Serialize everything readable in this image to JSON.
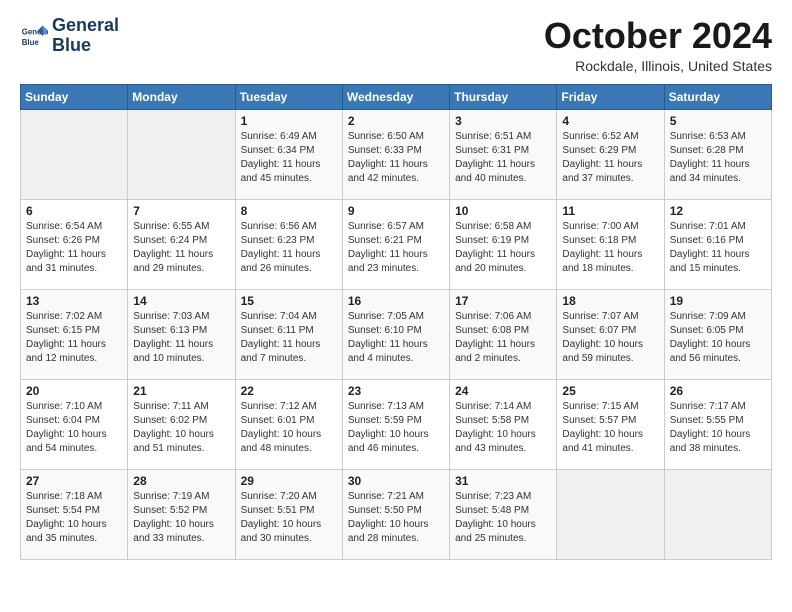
{
  "logo": {
    "line1": "General",
    "line2": "Blue"
  },
  "title": "October 2024",
  "location": "Rockdale, Illinois, United States",
  "days_header": [
    "Sunday",
    "Monday",
    "Tuesday",
    "Wednesday",
    "Thursday",
    "Friday",
    "Saturday"
  ],
  "weeks": [
    [
      {
        "day": "",
        "sunrise": "",
        "sunset": "",
        "daylight": ""
      },
      {
        "day": "",
        "sunrise": "",
        "sunset": "",
        "daylight": ""
      },
      {
        "day": "1",
        "sunrise": "Sunrise: 6:49 AM",
        "sunset": "Sunset: 6:34 PM",
        "daylight": "Daylight: 11 hours and 45 minutes."
      },
      {
        "day": "2",
        "sunrise": "Sunrise: 6:50 AM",
        "sunset": "Sunset: 6:33 PM",
        "daylight": "Daylight: 11 hours and 42 minutes."
      },
      {
        "day": "3",
        "sunrise": "Sunrise: 6:51 AM",
        "sunset": "Sunset: 6:31 PM",
        "daylight": "Daylight: 11 hours and 40 minutes."
      },
      {
        "day": "4",
        "sunrise": "Sunrise: 6:52 AM",
        "sunset": "Sunset: 6:29 PM",
        "daylight": "Daylight: 11 hours and 37 minutes."
      },
      {
        "day": "5",
        "sunrise": "Sunrise: 6:53 AM",
        "sunset": "Sunset: 6:28 PM",
        "daylight": "Daylight: 11 hours and 34 minutes."
      }
    ],
    [
      {
        "day": "6",
        "sunrise": "Sunrise: 6:54 AM",
        "sunset": "Sunset: 6:26 PM",
        "daylight": "Daylight: 11 hours and 31 minutes."
      },
      {
        "day": "7",
        "sunrise": "Sunrise: 6:55 AM",
        "sunset": "Sunset: 6:24 PM",
        "daylight": "Daylight: 11 hours and 29 minutes."
      },
      {
        "day": "8",
        "sunrise": "Sunrise: 6:56 AM",
        "sunset": "Sunset: 6:23 PM",
        "daylight": "Daylight: 11 hours and 26 minutes."
      },
      {
        "day": "9",
        "sunrise": "Sunrise: 6:57 AM",
        "sunset": "Sunset: 6:21 PM",
        "daylight": "Daylight: 11 hours and 23 minutes."
      },
      {
        "day": "10",
        "sunrise": "Sunrise: 6:58 AM",
        "sunset": "Sunset: 6:19 PM",
        "daylight": "Daylight: 11 hours and 20 minutes."
      },
      {
        "day": "11",
        "sunrise": "Sunrise: 7:00 AM",
        "sunset": "Sunset: 6:18 PM",
        "daylight": "Daylight: 11 hours and 18 minutes."
      },
      {
        "day": "12",
        "sunrise": "Sunrise: 7:01 AM",
        "sunset": "Sunset: 6:16 PM",
        "daylight": "Daylight: 11 hours and 15 minutes."
      }
    ],
    [
      {
        "day": "13",
        "sunrise": "Sunrise: 7:02 AM",
        "sunset": "Sunset: 6:15 PM",
        "daylight": "Daylight: 11 hours and 12 minutes."
      },
      {
        "day": "14",
        "sunrise": "Sunrise: 7:03 AM",
        "sunset": "Sunset: 6:13 PM",
        "daylight": "Daylight: 11 hours and 10 minutes."
      },
      {
        "day": "15",
        "sunrise": "Sunrise: 7:04 AM",
        "sunset": "Sunset: 6:11 PM",
        "daylight": "Daylight: 11 hours and 7 minutes."
      },
      {
        "day": "16",
        "sunrise": "Sunrise: 7:05 AM",
        "sunset": "Sunset: 6:10 PM",
        "daylight": "Daylight: 11 hours and 4 minutes."
      },
      {
        "day": "17",
        "sunrise": "Sunrise: 7:06 AM",
        "sunset": "Sunset: 6:08 PM",
        "daylight": "Daylight: 11 hours and 2 minutes."
      },
      {
        "day": "18",
        "sunrise": "Sunrise: 7:07 AM",
        "sunset": "Sunset: 6:07 PM",
        "daylight": "Daylight: 10 hours and 59 minutes."
      },
      {
        "day": "19",
        "sunrise": "Sunrise: 7:09 AM",
        "sunset": "Sunset: 6:05 PM",
        "daylight": "Daylight: 10 hours and 56 minutes."
      }
    ],
    [
      {
        "day": "20",
        "sunrise": "Sunrise: 7:10 AM",
        "sunset": "Sunset: 6:04 PM",
        "daylight": "Daylight: 10 hours and 54 minutes."
      },
      {
        "day": "21",
        "sunrise": "Sunrise: 7:11 AM",
        "sunset": "Sunset: 6:02 PM",
        "daylight": "Daylight: 10 hours and 51 minutes."
      },
      {
        "day": "22",
        "sunrise": "Sunrise: 7:12 AM",
        "sunset": "Sunset: 6:01 PM",
        "daylight": "Daylight: 10 hours and 48 minutes."
      },
      {
        "day": "23",
        "sunrise": "Sunrise: 7:13 AM",
        "sunset": "Sunset: 5:59 PM",
        "daylight": "Daylight: 10 hours and 46 minutes."
      },
      {
        "day": "24",
        "sunrise": "Sunrise: 7:14 AM",
        "sunset": "Sunset: 5:58 PM",
        "daylight": "Daylight: 10 hours and 43 minutes."
      },
      {
        "day": "25",
        "sunrise": "Sunrise: 7:15 AM",
        "sunset": "Sunset: 5:57 PM",
        "daylight": "Daylight: 10 hours and 41 minutes."
      },
      {
        "day": "26",
        "sunrise": "Sunrise: 7:17 AM",
        "sunset": "Sunset: 5:55 PM",
        "daylight": "Daylight: 10 hours and 38 minutes."
      }
    ],
    [
      {
        "day": "27",
        "sunrise": "Sunrise: 7:18 AM",
        "sunset": "Sunset: 5:54 PM",
        "daylight": "Daylight: 10 hours and 35 minutes."
      },
      {
        "day": "28",
        "sunrise": "Sunrise: 7:19 AM",
        "sunset": "Sunset: 5:52 PM",
        "daylight": "Daylight: 10 hours and 33 minutes."
      },
      {
        "day": "29",
        "sunrise": "Sunrise: 7:20 AM",
        "sunset": "Sunset: 5:51 PM",
        "daylight": "Daylight: 10 hours and 30 minutes."
      },
      {
        "day": "30",
        "sunrise": "Sunrise: 7:21 AM",
        "sunset": "Sunset: 5:50 PM",
        "daylight": "Daylight: 10 hours and 28 minutes."
      },
      {
        "day": "31",
        "sunrise": "Sunrise: 7:23 AM",
        "sunset": "Sunset: 5:48 PM",
        "daylight": "Daylight: 10 hours and 25 minutes."
      },
      {
        "day": "",
        "sunrise": "",
        "sunset": "",
        "daylight": ""
      },
      {
        "day": "",
        "sunrise": "",
        "sunset": "",
        "daylight": ""
      }
    ]
  ]
}
